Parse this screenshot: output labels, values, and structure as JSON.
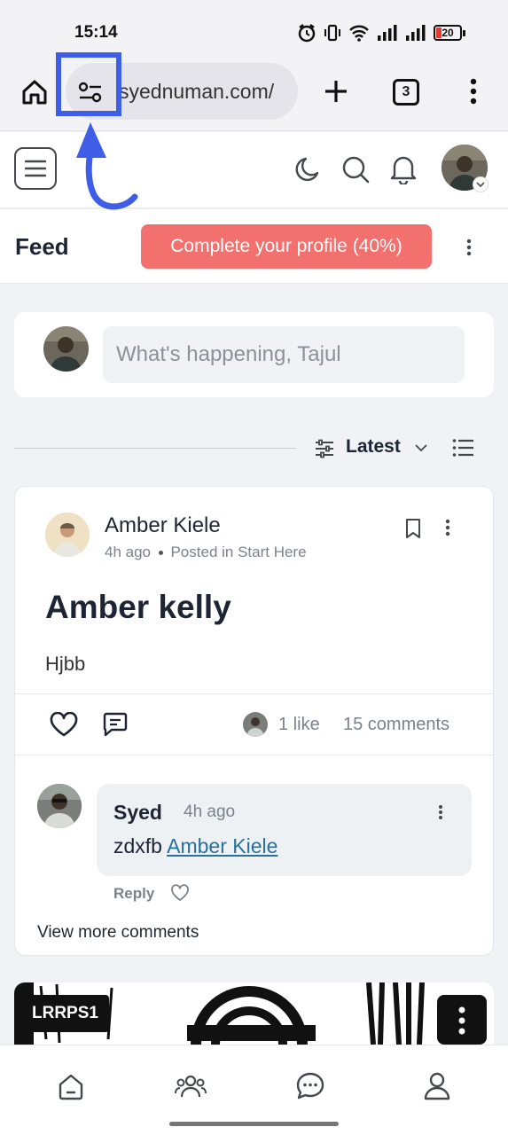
{
  "status_bar": {
    "time": "15:14",
    "battery": "20",
    "icons": [
      "alarm-icon",
      "vibrate-icon",
      "wifi-icon",
      "signal-icon",
      "signal-icon",
      "battery-icon"
    ]
  },
  "browser": {
    "url": "syednuman.com/",
    "tab_count": "3",
    "icons": [
      "home-icon",
      "site-settings-icon",
      "new-tab-icon",
      "tabs-icon",
      "more-icon"
    ],
    "highlight_color": "#3f5ee8"
  },
  "header": {
    "icons": [
      "menu-icon",
      "moon-icon",
      "search-icon",
      "bell-icon"
    ]
  },
  "feed": {
    "title": "Feed",
    "profile_button": "Complete your profile (40%)",
    "profile_button_color": "#f2706e"
  },
  "composer": {
    "placeholder": "What's happening, Tajul"
  },
  "sort": {
    "label": "Latest"
  },
  "post": {
    "author": "Amber Kiele",
    "time": "4h ago",
    "posted_in": "Posted in Start Here",
    "title": "Amber kelly",
    "body": "Hjbb",
    "likes": "1 like",
    "comments": "15 comments",
    "comment": {
      "author": "Syed",
      "time": "4h ago",
      "text": "zdxfb",
      "mention": "Amber Kiele",
      "reply": "Reply"
    },
    "view_more": "View more comments"
  },
  "media_post": {
    "label": "LRRPS1"
  },
  "bottom_nav": {
    "items": [
      "home-icon",
      "people-icon",
      "chat-icon",
      "profile-icon"
    ]
  }
}
